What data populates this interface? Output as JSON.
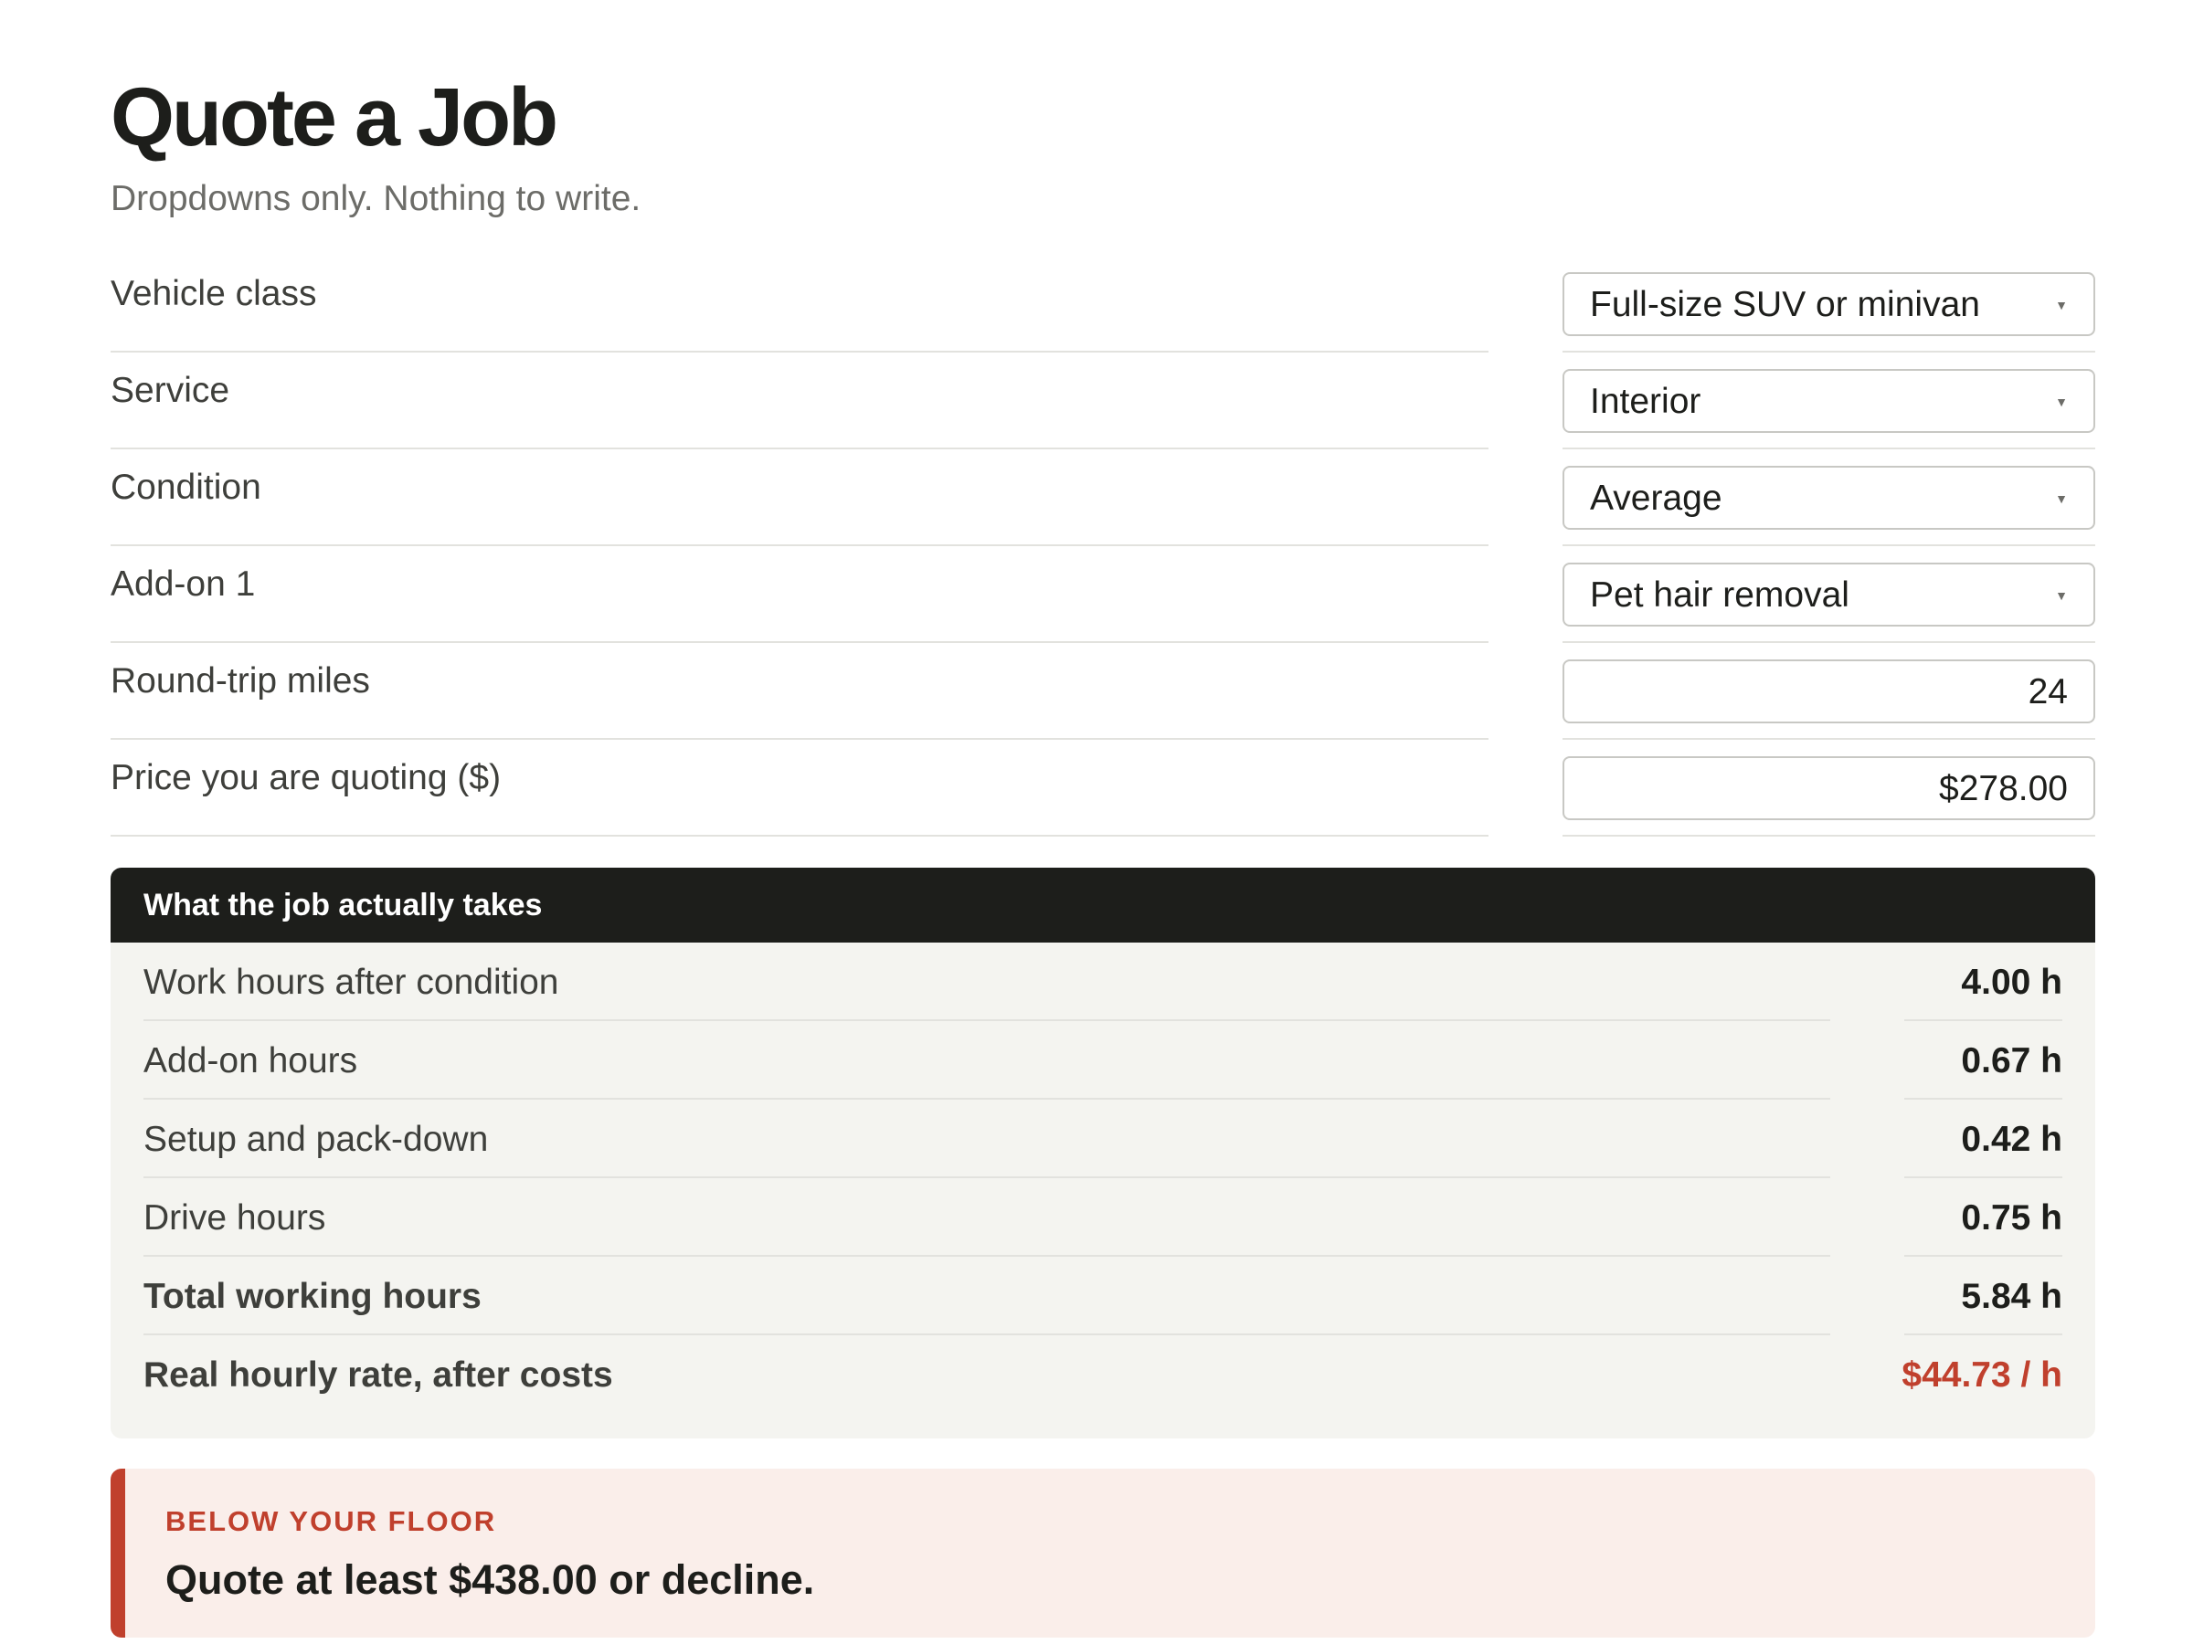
{
  "header": {
    "title": "Quote a Job",
    "subtitle": "Dropdowns only. Nothing to write."
  },
  "form": {
    "vehicle_class": {
      "label": "Vehicle class",
      "value": "Full-size SUV or minivan"
    },
    "service": {
      "label": "Service",
      "value": "Interior"
    },
    "condition": {
      "label": "Condition",
      "value": "Average"
    },
    "addon1": {
      "label": "Add-on 1",
      "value": "Pet hair removal"
    },
    "miles": {
      "label": "Round-trip miles",
      "value": "24"
    },
    "price": {
      "label": "Price you are quoting ($)",
      "value": "$278.00"
    }
  },
  "results": {
    "header": "What the job actually takes",
    "rows": [
      {
        "label": "Work hours after condition",
        "value": "4.00 h"
      },
      {
        "label": "Add-on hours",
        "value": "0.67 h"
      },
      {
        "label": "Setup and pack-down",
        "value": "0.42 h"
      },
      {
        "label": "Drive hours",
        "value": "0.75 h"
      },
      {
        "label": "Total working hours",
        "value": "5.84 h"
      },
      {
        "label": "Real hourly rate, after costs",
        "value": "$44.73 / h"
      }
    ]
  },
  "alert": {
    "kicker": "BELOW YOUR FLOOR",
    "message": "Quote at least $438.00 or decline."
  },
  "icons": {
    "caret": "caret-down-icon"
  },
  "colors": {
    "ink": "#1d1e1b",
    "muted": "#6c6c68",
    "panel": "#f4f4f0",
    "alert": "#c0402d",
    "alert_bg": "#faeeea"
  }
}
